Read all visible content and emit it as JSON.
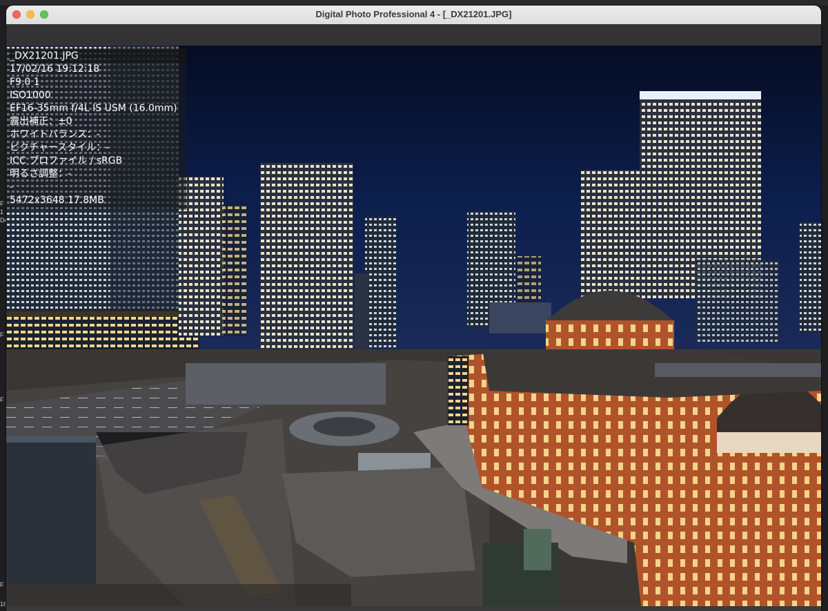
{
  "window": {
    "title": "Digital Photo Professional 4 - [_DX21201.JPG]"
  },
  "icons": {
    "close": "close-icon",
    "minimize": "minimize-icon",
    "maximize": "maximize-icon"
  },
  "colors": {
    "close": "#ec6b5e",
    "minimize": "#f4bf4f",
    "maximize": "#61c554"
  },
  "left_edge_fragments": [
    "F",
    "1",
    "De",
    "F",
    "F",
    "F",
    "16"
  ],
  "info": {
    "filename": "_DX21201.JPG",
    "datetime": "17/02/16 19:12:18",
    "aperture": "F9.0 1",
    "iso": "ISO1000",
    "lens": "EF16-35mm f/4L IS USM (16.0mm)",
    "exposure_comp": "露出補正：±0",
    "white_balance": "ホワイトバランス：-",
    "picture_style": "ピクチャースタイル：-",
    "icc_profile": "ICC プロファイル / sRGB",
    "brightness": "明るさ調整：-",
    "dash": "-",
    "dimensions": "5472x3648 17.8MB"
  }
}
